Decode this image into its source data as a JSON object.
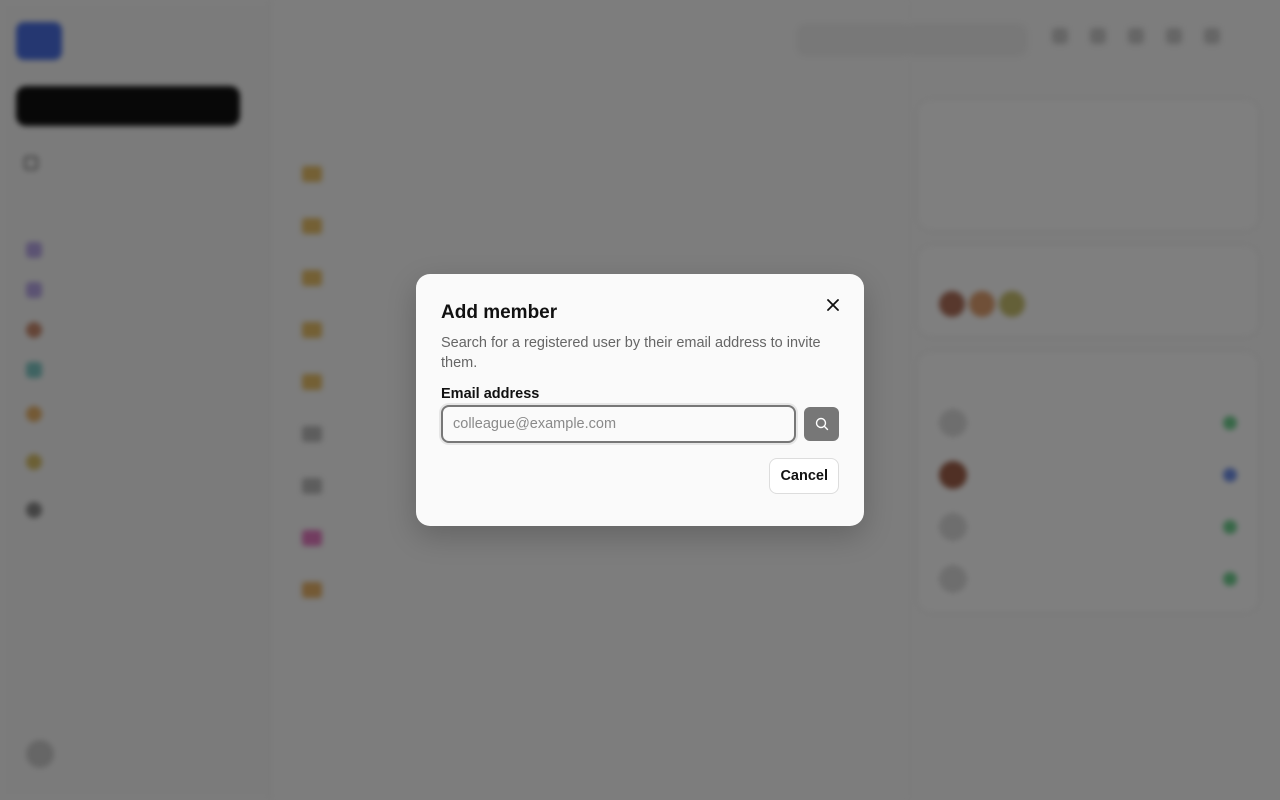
{
  "dialog": {
    "title": "Add member",
    "description": "Search for a registered user by their email address to invite them.",
    "email_label": "Email address",
    "email_placeholder": "colleague@example.com",
    "email_value": "",
    "cancel_label": "Cancel"
  },
  "icons": {
    "close": "close-icon",
    "search": "search-icon"
  },
  "colors": {
    "overlay": "#808080",
    "dialog_bg": "#fafafa",
    "search_button": "#777777"
  }
}
